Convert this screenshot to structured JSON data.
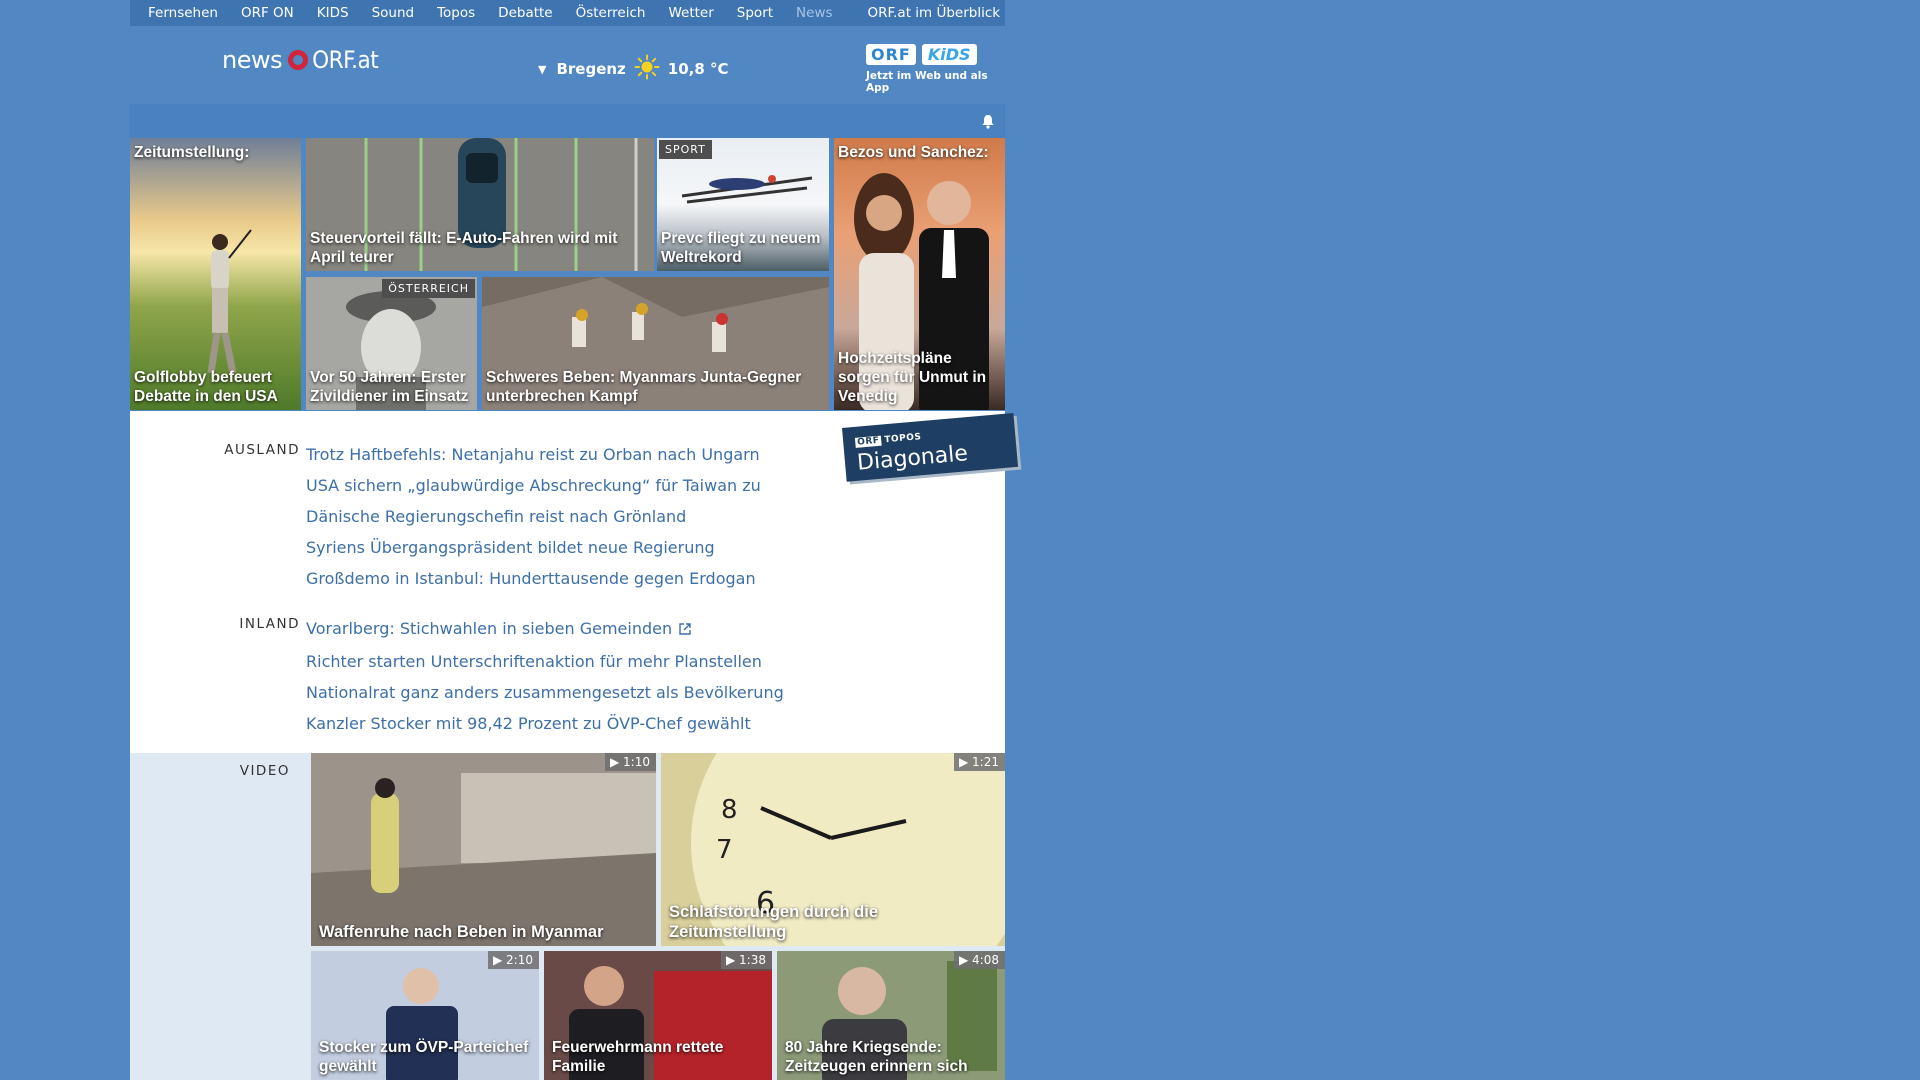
{
  "nav": {
    "items": [
      "Fernsehen",
      "ORF ON",
      "KIDS",
      "Sound",
      "Topos",
      "Debatte",
      "Österreich",
      "Wetter",
      "Sport"
    ],
    "current": "News",
    "overview": "ORF.at im Überblick"
  },
  "header": {
    "logo_news": "news",
    "logo_domain": "ORF.at",
    "weather_city": "Bregenz",
    "weather_temp": "10,8 °C",
    "kids_orf": "ORF",
    "kids_kids": "KiDS",
    "kids_tagline": "Jetzt im Web und als App"
  },
  "tiles": {
    "golf": {
      "kicker": "Zeitumstellung:",
      "caption": "Golflobby befeuert Debatte in den USA"
    },
    "eauto": {
      "caption": "Steuervorteil fällt: E-Auto-Fahren wird mit April teurer"
    },
    "prevc": {
      "badge": "SPORT",
      "caption": "Prevc fliegt zu neuem Weltrekord"
    },
    "bezos": {
      "kicker": "Bezos und Sanchez:",
      "caption": "Hochzeitspläne sorgen für Unmut in Venedig"
    },
    "zivil": {
      "badge": "ÖSTERREICH",
      "caption": "Vor 50 Jahren: Erster Zivildiener im Einsatz"
    },
    "beben": {
      "caption": "Schweres Beben: Myanmars Junta-Gegner unterbrechen Kampf"
    }
  },
  "ausland": {
    "label": "AUSLAND",
    "links": [
      "Trotz Haftbefehls: Netanjahu reist zu Orban nach Ungarn",
      "USA sichern „glaubwürdige Abschreckung“ für Taiwan zu",
      "Dänische Regierungschefin reist nach Grönland",
      "Syriens Übergangspräsident bildet neue Regierung",
      "Großdemo in Istanbul: Hunderttausende gegen Erdogan"
    ]
  },
  "inland": {
    "label": "INLAND",
    "links": [
      "Vorarlberg: Stichwahlen in sieben Gemeinden",
      "Richter starten Unterschriftenaktion für mehr Planstellen",
      "Nationalrat ganz anders zusammengesetzt als Bevölkerung",
      "Kanzler Stocker mit 98,42 Prozent zu ÖVP-Chef gewählt"
    ]
  },
  "topos": {
    "small_orf": "ORF",
    "small": "TOPOS",
    "title": "Diagonale"
  },
  "video": {
    "label": "VIDEO",
    "items": [
      {
        "duration": "1:10",
        "caption": "Waffenruhe nach Beben in Myanmar"
      },
      {
        "duration": "1:21",
        "caption": "Schlafstörungen durch die Zeitumstellung"
      },
      {
        "duration": "2:10",
        "caption": "Stocker zum ÖVP-Parteichef gewählt"
      },
      {
        "duration": "1:38",
        "caption": "Feuerwehrmann rettete Familie"
      },
      {
        "duration": "4:08",
        "caption": "80 Jahre Kriegsende: Zeitzeugen erinnern sich"
      }
    ]
  },
  "colors": {
    "background": "#5188c4",
    "link": "#3d6fa8",
    "logo_red": "#d0253a",
    "video_bg": "#dfe9f3"
  }
}
